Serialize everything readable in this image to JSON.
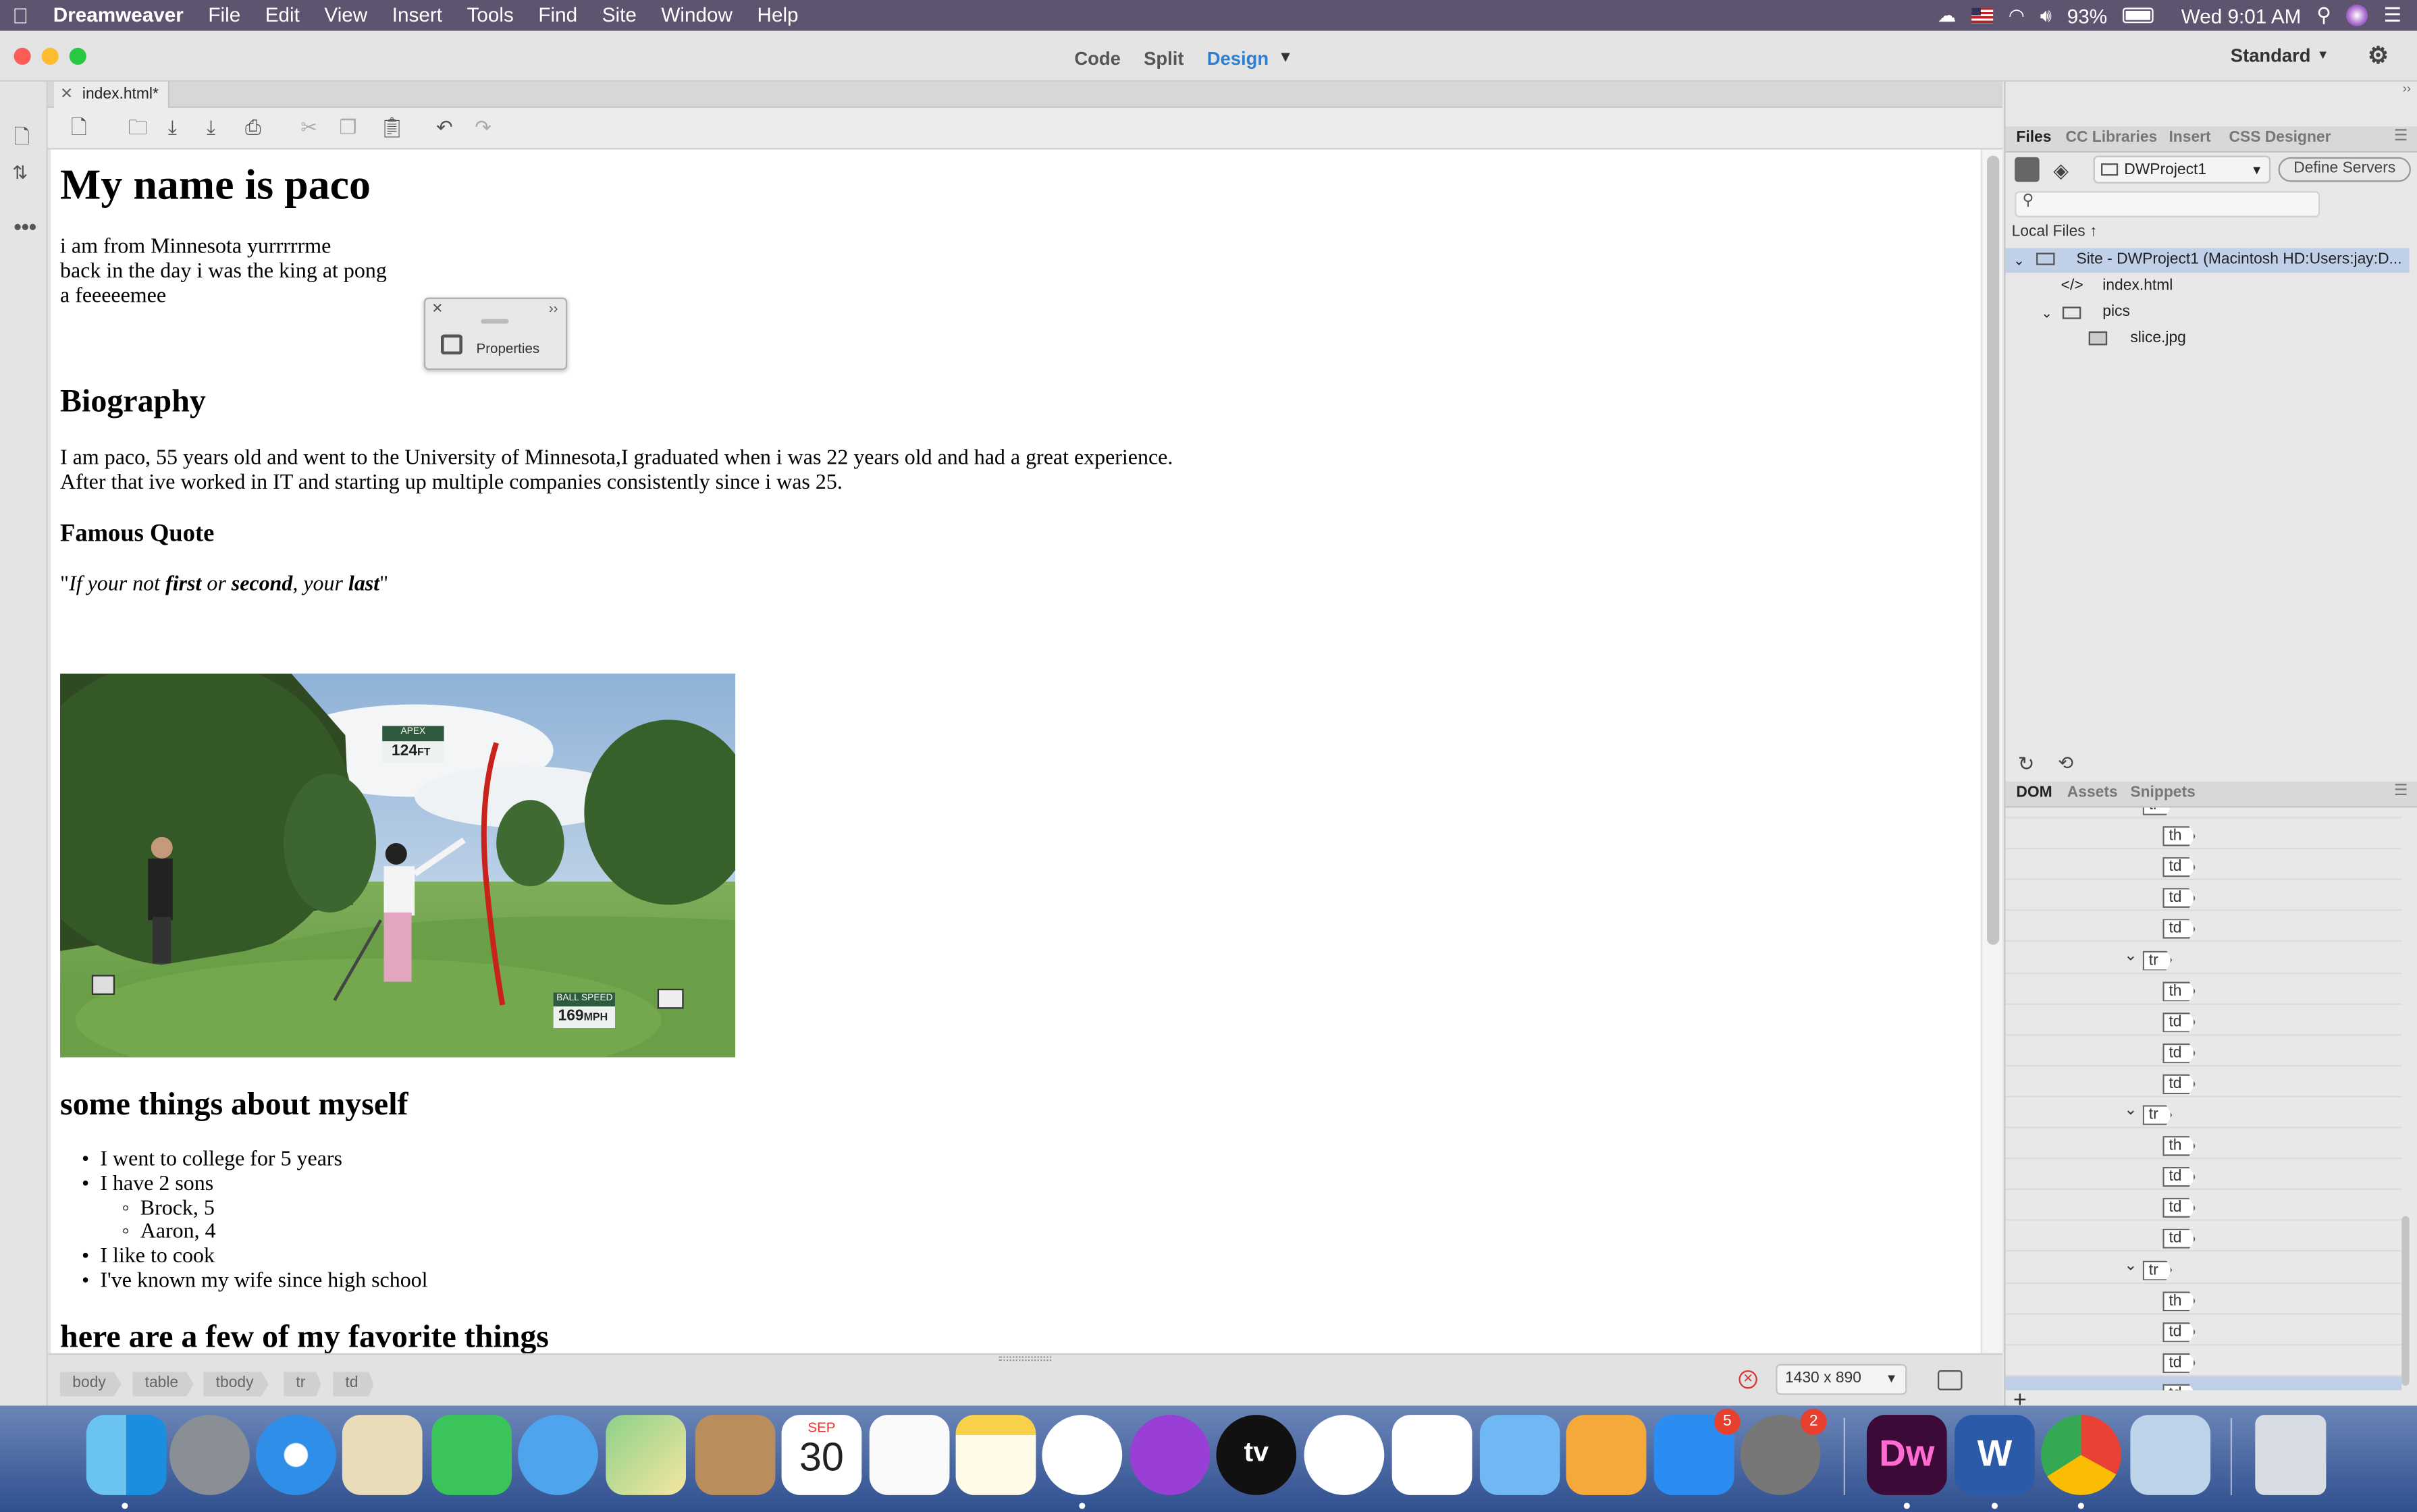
{
  "menubar": {
    "apple": "",
    "app_name": "Dreamweaver",
    "items": [
      "File",
      "Edit",
      "View",
      "Insert",
      "Tools",
      "Find",
      "Site",
      "Window",
      "Help"
    ],
    "battery": "93%",
    "clock": "Wed 9:01 AM"
  },
  "window": {
    "view_modes": {
      "code": "Code",
      "split": "Split",
      "design": "Design"
    },
    "workspace": "Standard",
    "doc_tab": "index.html*"
  },
  "page": {
    "h1": "My name is paco",
    "intro_lines": [
      "i am from Minnesota yurrrrrme",
      "back in the day i was the king at pong",
      "a feeeeemee"
    ],
    "biography_heading": "Biography",
    "bio_lines": [
      "I am paco, 55 years old and went to the University of Minnesota,I graduated when i was 22 years old and had a great experience.",
      "After that ive worked in IT and starting up multiple companies consistently since i was 25."
    ],
    "quote_heading": "Famous Quote",
    "quote": {
      "open": "\"",
      "p1": "If your not ",
      "b1": "first",
      "p2": " or ",
      "b2": "second",
      "p3": ", your ",
      "b3": "last",
      "close": "\""
    },
    "image_overlay": {
      "apex_label": "APEX",
      "apex_value": "124",
      "apex_unit": "FT",
      "speed_label": "BALL SPEED",
      "speed_value": "169",
      "speed_unit": "MPH"
    },
    "about_heading": "some things about myself",
    "about_items": [
      {
        "text": "I went to college for 5 years",
        "level": 1
      },
      {
        "text": "I have 2 sons",
        "level": 1
      },
      {
        "text": "Brock, 5",
        "level": 2
      },
      {
        "text": "Aaron, 4",
        "level": 2
      },
      {
        "text": "I like to cook",
        "level": 1
      },
      {
        "text": "I've known my wife since high school",
        "level": 1
      }
    ],
    "favorites_heading": "here are a few of my favorite things"
  },
  "properties_panel": {
    "label": "Properties"
  },
  "statusbar": {
    "breadcrumbs": [
      "body",
      "table",
      "tbody",
      "tr",
      "td"
    ],
    "viewport_size": "1430 x 890"
  },
  "files_panel": {
    "tabs": [
      "Files",
      "CC Libraries",
      "Insert",
      "CSS Designer"
    ],
    "site_select": "DWProject1",
    "define_servers": "Define Servers",
    "local_files_label": "Local Files",
    "tree": [
      {
        "label": "Site - DWProject1 (Macintosh HD:Users:jay:D...",
        "kind": "site"
      },
      {
        "label": "index.html",
        "kind": "html"
      },
      {
        "label": "pics",
        "kind": "folder"
      },
      {
        "label": "slice.jpg",
        "kind": "image"
      }
    ]
  },
  "dom_panel": {
    "tabs": [
      "DOM",
      "Assets",
      "Snippets"
    ],
    "rows": [
      {
        "tag": "tr",
        "level": 1
      },
      {
        "tag": "th",
        "level": 2
      },
      {
        "tag": "td",
        "level": 2
      },
      {
        "tag": "td",
        "level": 2
      },
      {
        "tag": "td",
        "level": 2
      },
      {
        "tag": "tr",
        "level": 1
      },
      {
        "tag": "th",
        "level": 2
      },
      {
        "tag": "td",
        "level": 2
      },
      {
        "tag": "td",
        "level": 2
      },
      {
        "tag": "td",
        "level": 2
      },
      {
        "tag": "tr",
        "level": 1
      },
      {
        "tag": "th",
        "level": 2
      },
      {
        "tag": "td",
        "level": 2
      },
      {
        "tag": "td",
        "level": 2
      },
      {
        "tag": "td",
        "level": 2
      },
      {
        "tag": "tr",
        "level": 1
      },
      {
        "tag": "th",
        "level": 2
      },
      {
        "tag": "td",
        "level": 2
      },
      {
        "tag": "td",
        "level": 2
      },
      {
        "tag": "td",
        "level": 2
      }
    ],
    "add_symbol": "+"
  },
  "dock": {
    "calendar_month": "SEP",
    "calendar_day": "30",
    "appstore_badge": "5",
    "prefs_badge": "2",
    "dw_label": "Dw",
    "word_label": "W",
    "tv_label": "tv"
  }
}
